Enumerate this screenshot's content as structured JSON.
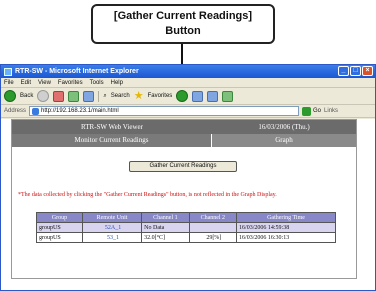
{
  "callout": {
    "line1": "[Gather Current Readings]",
    "line2": "Button"
  },
  "browser": {
    "title": "RTR-SW - Microsoft Internet Explorer",
    "menus": [
      "File",
      "Edit",
      "View",
      "Favorites",
      "Tools",
      "Help"
    ],
    "toolbar": {
      "back_label": "Back",
      "search_label": "Search",
      "favorites_label": "Favorites"
    },
    "address": {
      "label": "Address",
      "url": "http://192.168.23.1/main.html",
      "go_label": "Go",
      "links_label": "Links"
    }
  },
  "page": {
    "app_title": "RTR-SW Web Viewer",
    "date": "16/03/2006 (Thu.)",
    "nav": {
      "monitor": "Monitor Current Readings",
      "graph": "Graph"
    },
    "gather_button": "Gather Current Readings",
    "note": "*The data collected by clicking the \"Gather Current Readings\" button, is not reflected in the Graph Display.",
    "table": {
      "headers": [
        "Group",
        "Remote Unit",
        "Channel 1",
        "Channel 2",
        "Gathering Time"
      ],
      "rows": [
        [
          "groupUS",
          "52A_1",
          "No Data",
          "",
          "16/03/2006 14:59:38"
        ],
        [
          "groupUS",
          "53_1",
          "32.0[°C]",
          "29[%]",
          "16/03/2006 16:30:13"
        ]
      ]
    }
  },
  "colors": {
    "title_bar": "#1b56d4",
    "header_gray": "#6b6b6b",
    "table_header": "#8888c8",
    "note_red": "#cc1111",
    "highlight_row": "#d8d4f0"
  }
}
